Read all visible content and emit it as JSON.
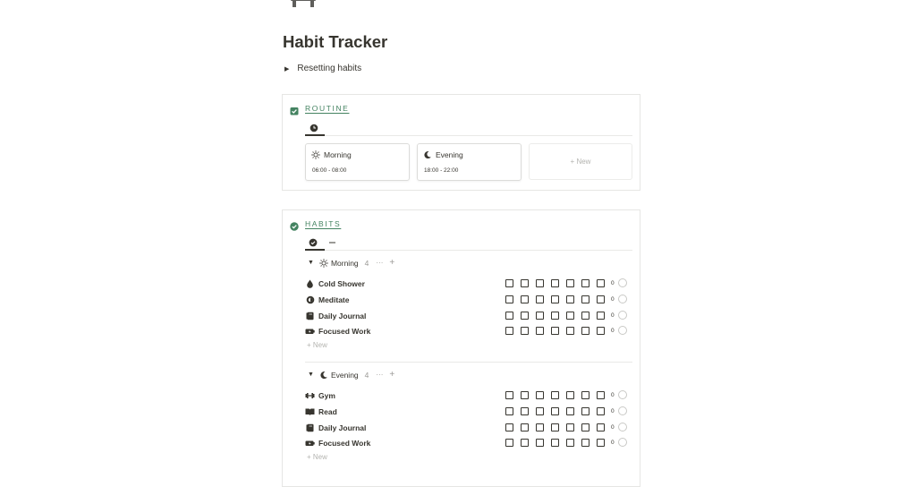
{
  "page": {
    "icon": "desk-icon",
    "title": "Habit Tracker",
    "toggle_label": "Resetting habits"
  },
  "routine": {
    "icon": "calendar-check-icon",
    "label": "ROUTINE",
    "tab_icon": "clock-icon",
    "cards": [
      {
        "icon": "sun-icon",
        "title": "Morning",
        "time": "06:00 - 08:00"
      },
      {
        "icon": "moon-icon",
        "title": "Evening",
        "time": "18:00 - 22:00"
      }
    ],
    "new_label": "+ New"
  },
  "habits": {
    "icon": "check-circle-icon",
    "label": "HABITS",
    "tab_icons": [
      "check-circle-icon",
      "minus-icon"
    ],
    "groups": [
      {
        "icon": "sun-icon",
        "name": "Morning",
        "count": "4",
        "more": "···",
        "add": "+",
        "items": [
          {
            "icon": "droplet-icon",
            "name": "Cold Shower",
            "score": "0"
          },
          {
            "icon": "meditation-icon",
            "name": "Meditate",
            "score": "0"
          },
          {
            "icon": "notebook-icon",
            "name": "Daily Journal",
            "score": "0"
          },
          {
            "icon": "battery-icon",
            "name": "Focused Work",
            "score": "0"
          }
        ],
        "new_label": "+ New"
      },
      {
        "icon": "moon-icon",
        "name": "Evening",
        "count": "4",
        "more": "···",
        "add": "+",
        "items": [
          {
            "icon": "dumbbell-icon",
            "name": "Gym",
            "score": "0"
          },
          {
            "icon": "book-icon",
            "name": "Read",
            "score": "0"
          },
          {
            "icon": "notebook-icon",
            "name": "Daily Journal",
            "score": "0"
          },
          {
            "icon": "battery-icon",
            "name": "Focused Work",
            "score": "0"
          }
        ],
        "new_label": "+ New"
      }
    ]
  },
  "colors": {
    "accent_green": "#448361",
    "text": "#37352f",
    "muted": "#9b9a97",
    "border": "#e6e6e4"
  }
}
